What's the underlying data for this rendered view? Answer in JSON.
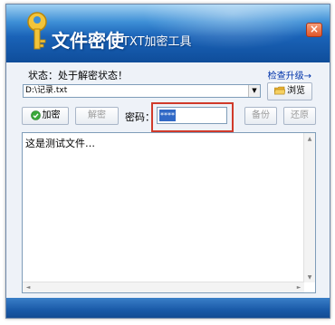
{
  "window": {
    "title_main": "文件密使",
    "title_sub": "TXT加密工具",
    "close_glyph": "×"
  },
  "status": {
    "text": "状态：处于解密状态！"
  },
  "upgrade_link": "检查升级→",
  "file": {
    "path": "D:\\记录.txt",
    "arrow": "▼",
    "browse_label": "浏览"
  },
  "toolbar": {
    "encrypt_label": "加密",
    "decrypt_label": "解密",
    "password_label": "密码：",
    "password_value": "****",
    "backup_label": "备份",
    "restore_label": "还原"
  },
  "editor": {
    "content": "这是测试文件…"
  },
  "scroll": {
    "up": "▲",
    "down": "▼",
    "left": "◄",
    "right": "►"
  },
  "colors": {
    "title_bar": "#1a63b8",
    "highlight_box": "#d03a2a",
    "selection": "#3169c6",
    "link": "#0033aa"
  }
}
